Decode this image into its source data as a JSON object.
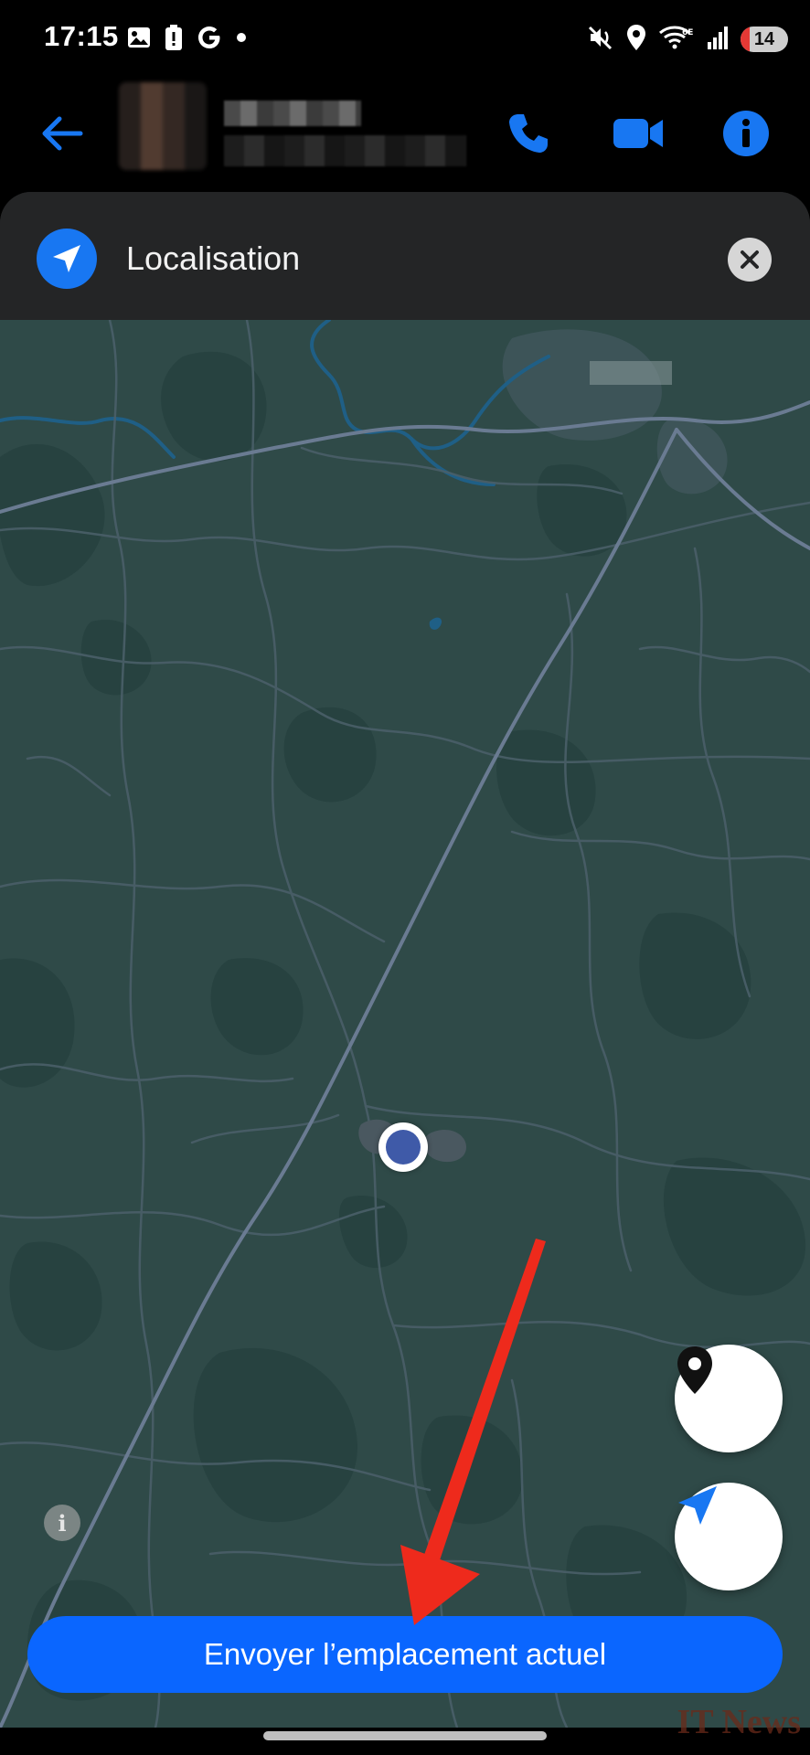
{
  "status_bar": {
    "time": "17:15",
    "battery_level": "14",
    "left_icons": [
      "image-icon",
      "battery-alert-icon",
      "google-icon",
      "dot-icon"
    ],
    "right_icons": [
      "mute-vibrate-icon",
      "location-icon",
      "wifi-6e-icon",
      "signal-icon",
      "battery-icon"
    ]
  },
  "app_bar": {
    "icons": [
      "back-arrow-icon",
      "phone-icon",
      "video-camera-icon",
      "info-icon"
    ],
    "accent": "#1877f2"
  },
  "sheet": {
    "title": "Localisation",
    "header_icon": "navigation-arrow-icon",
    "close_icon": "close-icon"
  },
  "map": {
    "background": "#2f4a48",
    "info_label": "i",
    "controls": [
      "map-pin-icon",
      "navigation-arrow-icon"
    ]
  },
  "send_button": {
    "label": "Envoyer l’emplacement actuel",
    "color": "#0a66ff"
  },
  "watermark": "IT News"
}
